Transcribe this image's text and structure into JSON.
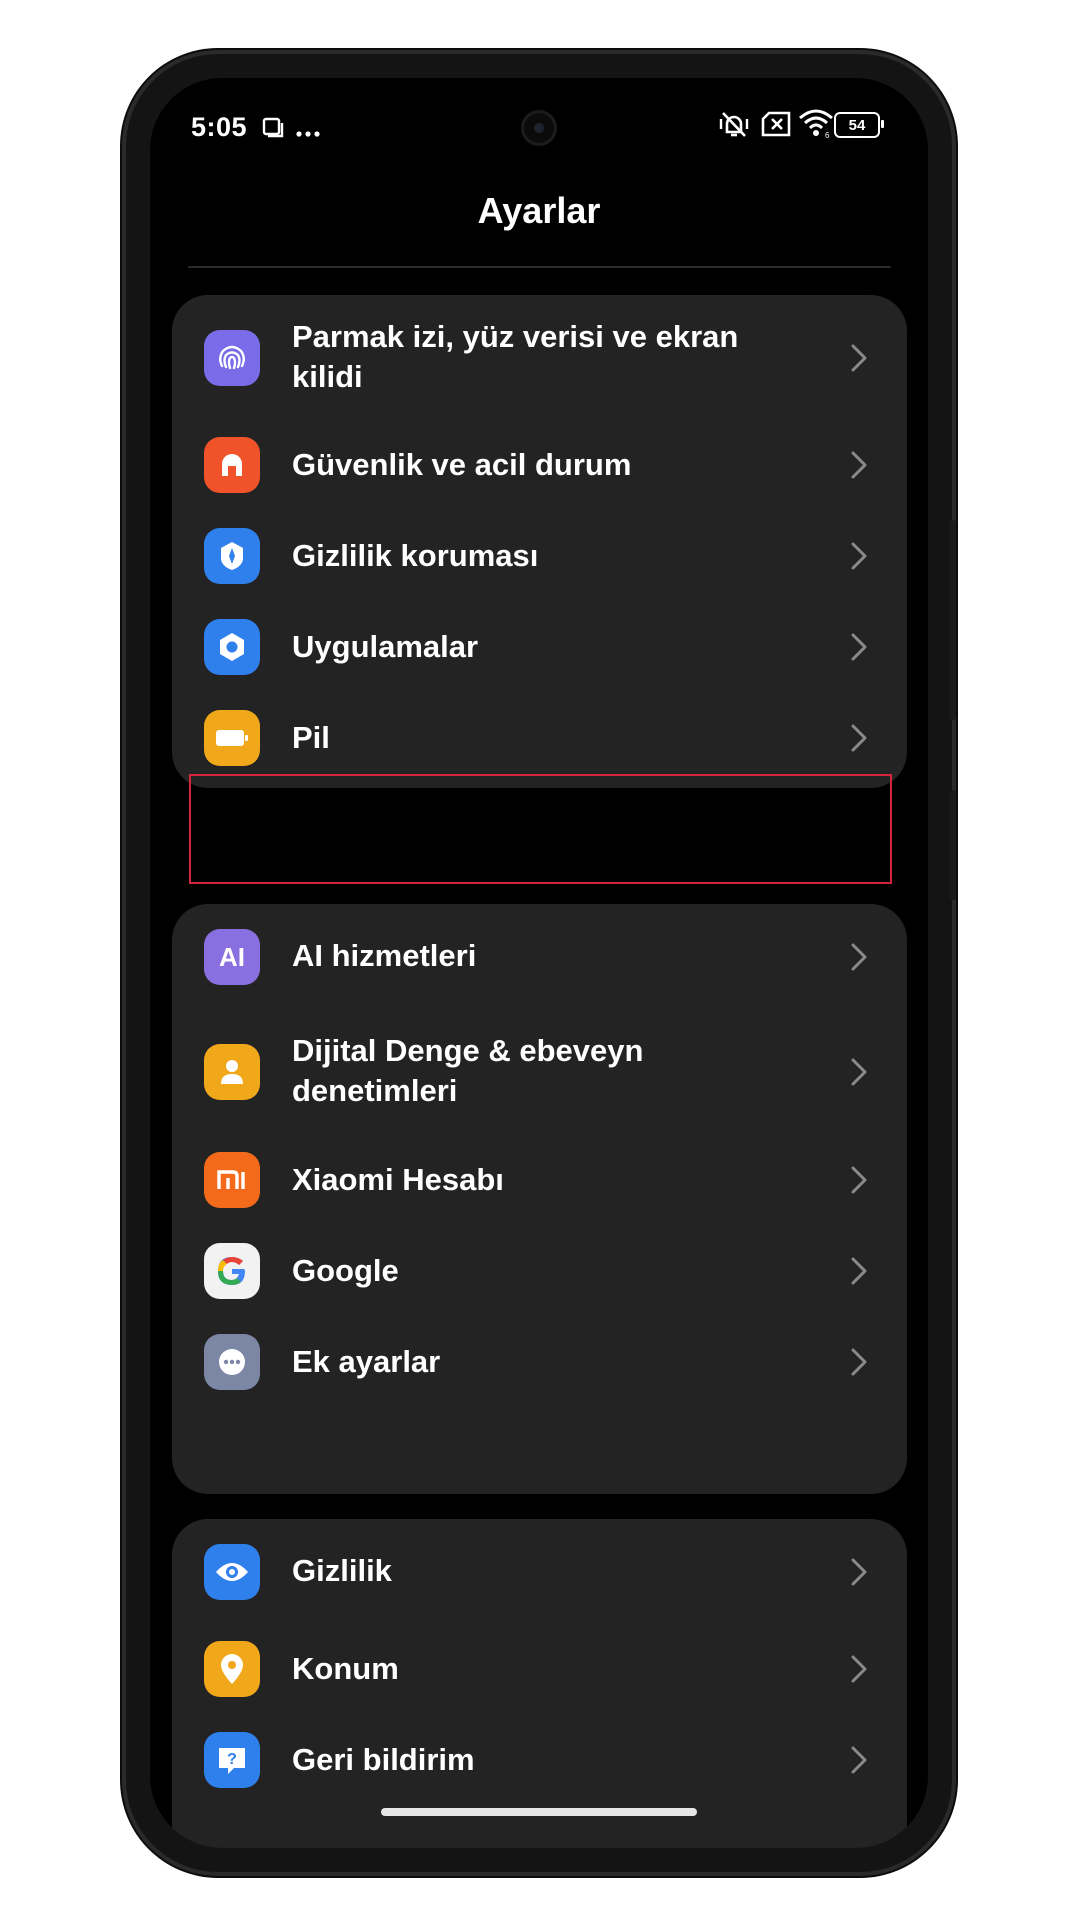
{
  "status_bar": {
    "time": "5:05",
    "battery": "54",
    "icons": [
      "screen-record-icon",
      "more-dots-icon",
      "vibrate-off-icon",
      "no-sim-icon",
      "wifi-icon",
      "battery-icon"
    ]
  },
  "header": {
    "title": "Ayarlar"
  },
  "groups": [
    {
      "items": [
        {
          "label": "Parmak izi, yüz verisi ve ekran kilidi",
          "icon": "fingerprint-icon",
          "color": "#7A6BE8"
        },
        {
          "label": "Güvenlik ve acil durum",
          "icon": "emergency-siren-icon",
          "color": "#F0532A"
        },
        {
          "label": "Gizlilik koruması",
          "icon": "privacy-shield-icon",
          "color": "#2F80ED"
        },
        {
          "label": "Uygulamalar",
          "icon": "apps-gear-icon",
          "color": "#2F80ED"
        },
        {
          "label": "Pil",
          "icon": "battery-app-icon",
          "color": "#F0A81A",
          "highlighted": true
        }
      ]
    },
    {
      "items": [
        {
          "label": "AI hizmetleri",
          "icon": "ai-icon",
          "color": "#8A6FE0"
        },
        {
          "label": "Dijital Denge & ebeveyn denetimleri",
          "icon": "digital-wellbeing-icon",
          "color": "#F0A81A"
        },
        {
          "label": "Xiaomi Hesabı",
          "icon": "xiaomi-logo-icon",
          "color": "#F36A1A"
        },
        {
          "label": "Google",
          "icon": "google-logo-icon",
          "color": "#F2F2F2"
        },
        {
          "label": "Ek ayarlar",
          "icon": "more-settings-icon",
          "color": "#7C87A6"
        }
      ]
    },
    {
      "items": [
        {
          "label": "Gizlilik",
          "icon": "eye-icon",
          "color": "#2F80ED"
        },
        {
          "label": "Konum",
          "icon": "location-pin-icon",
          "color": "#F0A81A"
        },
        {
          "label": "Geri bildirim",
          "icon": "feedback-question-icon",
          "color": "#2F80ED"
        }
      ]
    }
  ],
  "highlight_color": "#D3263D"
}
